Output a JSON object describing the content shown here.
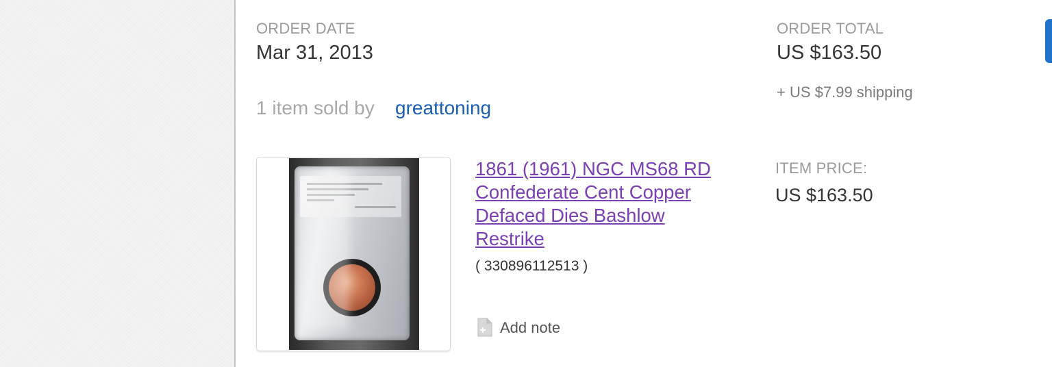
{
  "order": {
    "date_label": "ORDER DATE",
    "date_value": "Mar 31, 2013",
    "total_label": "ORDER TOTAL",
    "total_value": "US $163.50",
    "shipping_text": "+ US $7.99 shipping"
  },
  "seller": {
    "sold_by_text": "1 item sold by",
    "name": "greattoning"
  },
  "item": {
    "title": "1861 (1961) NGC MS68 RD Confederate Cent Copper Defaced Dies Bashlow Restrike",
    "number": "( 330896112513 )",
    "price_label": "ITEM PRICE:",
    "price_value": "US $163.50",
    "thumbnail_alt": "coin-in-ngc-slab",
    "add_note_label": "Add note",
    "note_icon": "note-add-icon"
  },
  "colors": {
    "link_blue": "#1a5fb4",
    "visited_purple": "#7b3fb4",
    "accent_tab": "#1f73c8"
  }
}
